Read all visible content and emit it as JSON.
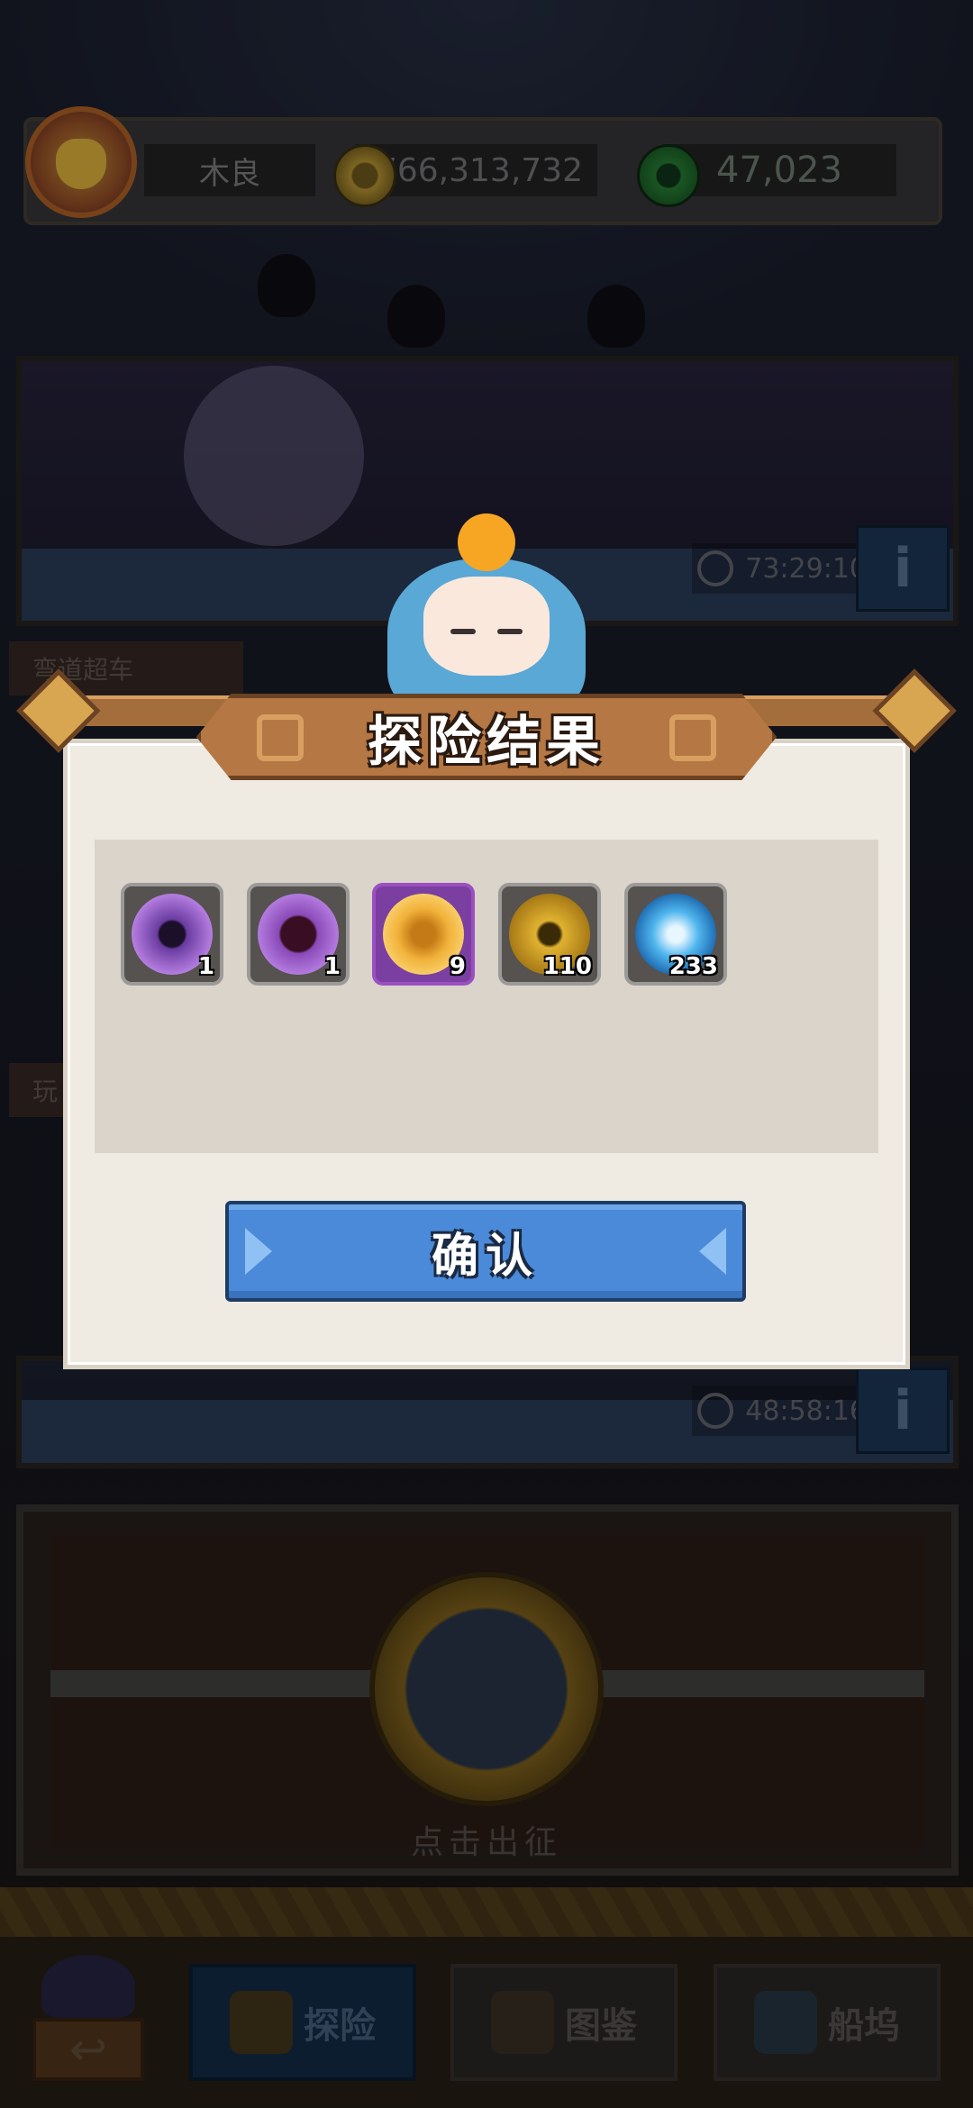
{
  "header": {
    "player_name": "木良",
    "coins": "766,313,732",
    "gems": "47,023"
  },
  "scenes": {
    "stage1_timer": "73:29:10",
    "stage2_timer": "48:58:16",
    "info_label": "i",
    "stage_tag_1": "弯道超车",
    "stage_tag_2": "玩"
  },
  "dock": {
    "launch_label": "点击出征"
  },
  "nav": {
    "back_label": "↩",
    "tabs": [
      {
        "label": "探险",
        "active": true
      },
      {
        "label": "图鉴",
        "active": false
      },
      {
        "label": "船坞",
        "active": false
      }
    ]
  },
  "modal": {
    "title": "探险结果",
    "confirm_label": "确认",
    "rewards": [
      {
        "icon": "purple-vortex-orb-icon",
        "qty": "1"
      },
      {
        "icon": "purple-mask-orb-icon",
        "qty": "1"
      },
      {
        "icon": "golden-scarab-icon",
        "qty": "9"
      },
      {
        "icon": "gold-coins-icon",
        "qty": "110"
      },
      {
        "icon": "blue-crystal-icon",
        "qty": "233"
      }
    ]
  },
  "colors": {
    "confirm_blue": "#4b8ad8",
    "banner_brown": "#b57743",
    "rare_purple": "#9b4fc0"
  }
}
